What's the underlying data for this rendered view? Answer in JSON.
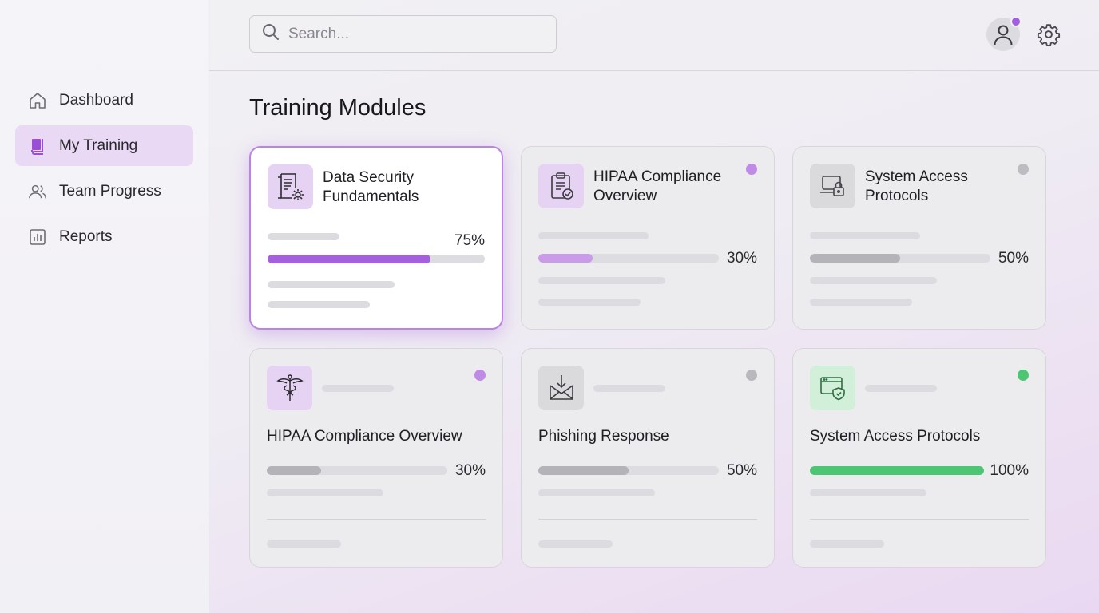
{
  "sidebar": {
    "items": [
      {
        "label": "Dashboard",
        "icon": "home-icon",
        "active": false
      },
      {
        "label": "My Training",
        "icon": "book-icon",
        "active": true
      },
      {
        "label": "Team Progress",
        "icon": "users-icon",
        "active": false
      },
      {
        "label": "Reports",
        "icon": "bar-chart-icon",
        "active": false
      }
    ]
  },
  "header": {
    "search_placeholder": "Search...",
    "notification_color": "#a35ee0"
  },
  "main": {
    "title": "Training Modules",
    "modules": [
      {
        "name": "Data Security Fundamentals",
        "icon": "document-gear-icon",
        "progress": 75,
        "progress_label": "75%",
        "fill_color": "#a362dc",
        "featured": true
      },
      {
        "name": "HIPAA Compliance Overview",
        "icon": "clipboard-check-icon",
        "progress": 30,
        "progress_label": "30%",
        "fill_color": "#c99be8",
        "status_color": "#c08be6"
      },
      {
        "name": "System Access Protocols",
        "icon": "laptop-lock-icon",
        "progress": 50,
        "progress_label": "50%",
        "fill_color": "#b4b3b7",
        "status_color": "#bdbcc0"
      },
      {
        "name": "HIPAA Compliance Overview",
        "icon": "caduceus-icon",
        "progress": 30,
        "progress_label": "30%",
        "fill_color": "#b4b3b7",
        "status_color": "#c08be6"
      },
      {
        "name": "Phishing Response",
        "icon": "envelope-download-icon",
        "progress": 50,
        "progress_label": "50%",
        "fill_color": "#b4b3b7",
        "status_color": "#b9b8bc"
      },
      {
        "name": "System Access Protocols",
        "icon": "browser-shield-icon",
        "progress": 100,
        "progress_label": "100%",
        "fill_color": "#4cc672",
        "status_color": "#4cc672"
      }
    ]
  }
}
